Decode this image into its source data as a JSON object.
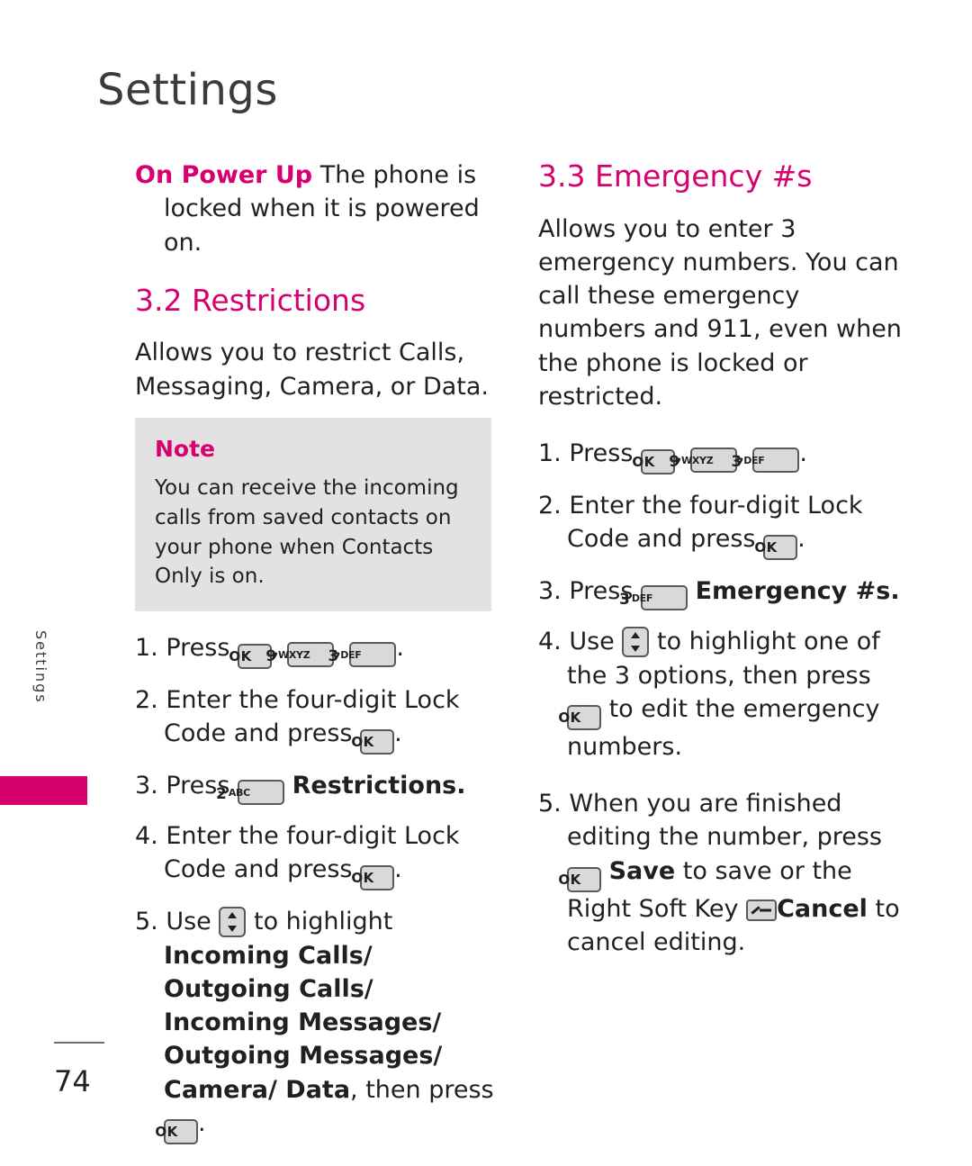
{
  "header": {
    "title": "Settings"
  },
  "side_tab": {
    "label": "Settings"
  },
  "footer": {
    "page_number": "74"
  },
  "left_column": {
    "on_power_up": {
      "term": "On Power Up",
      "text": " The phone is locked when it is powered on."
    },
    "section_32": {
      "heading": "3.2 Restrictions",
      "intro": "Allows you to restrict Calls, Messaging, Camera, or Data."
    },
    "note": {
      "title": "Note",
      "body": "You can receive the incoming calls from saved contacts on your phone when Contacts Only is on."
    },
    "steps": {
      "s1_prefix": "1. Press",
      "s1_comma1": ",",
      "s1_comma2": ",",
      "s1_end": ".",
      "s2": "2. Enter the four-digit Lock Code and press",
      "s2_end": ".",
      "s3_prefix": "3. Press",
      "s3_bold": "Restrictions.",
      "s4": "4. Enter the four-digit Lock Code and press",
      "s4_end": ".",
      "s5_prefix": "5. Use",
      "s5_mid": "to highlight",
      "s5_bold1": "Incoming Calls/ Outgoing Calls/ Incoming Messages/ Outgoing Messages/ Camera/ Data",
      "s5_tail": ", then press",
      "s5_end": "."
    }
  },
  "right_column": {
    "section_33": {
      "heading": "3.3 Emergency #s",
      "intro": "Allows you to enter 3 emergency numbers. You can call these emergency numbers and 911, even when the phone is locked or restricted."
    },
    "steps": {
      "s1_prefix": "1. Press",
      "s1_comma1": ",",
      "s1_comma2": ",",
      "s1_end": ".",
      "s2": "2. Enter the four-digit Lock Code and press",
      "s2_end": ".",
      "s3_prefix": "3. Press",
      "s3_bold": "Emergency #s.",
      "s4_prefix": "4. Use",
      "s4_mid": "to highlight one of the 3 options, then press",
      "s4_tail": "to edit the emergency numbers.",
      "s5_prefix": "5. When you are finished editing the number, press",
      "s5_bold1": "Save",
      "s5_mid": "to save or the Right Soft Key",
      "s5_bold2": "Cancel",
      "s5_tail": "to cancel editing."
    }
  },
  "keys": {
    "ok": "OK",
    "nine": "9",
    "nine_sup": "WXYZ",
    "three": "3",
    "three_sup": "DEF",
    "two": "2",
    "two_sup": "ABC",
    "nav": "nav-up-down-key",
    "soft_left": "left-soft-key",
    "soft_right": "right-soft-key"
  },
  "colors": {
    "accent": "#d6006e",
    "text": "#231f20",
    "note_bg": "#e2e2e2"
  }
}
